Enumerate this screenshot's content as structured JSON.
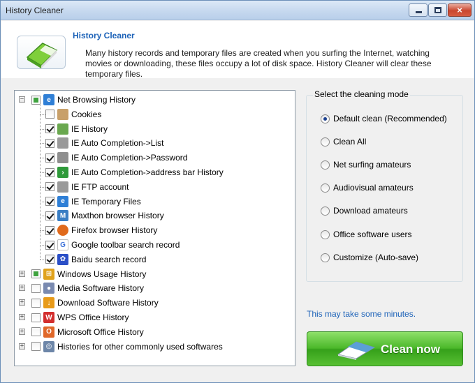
{
  "window": {
    "title": "History Cleaner",
    "controls": {
      "minimize": "minimize",
      "maximize": "maximize",
      "close": "×"
    }
  },
  "header": {
    "title": "History Cleaner",
    "description": "Many history records and temporary files are created when you surfing the Internet, watching movies or downloading, these files occupy a lot of disk space. History Cleaner will clear these temporary files."
  },
  "tree": {
    "groups": [
      {
        "label": "Net Browsing History",
        "state": "partial",
        "expanded": true,
        "icon": "ie-icon",
        "children": [
          {
            "label": "Cookies",
            "checked": false,
            "icon": "cookie-icon"
          },
          {
            "label": "IE History",
            "checked": true,
            "icon": "history-icon"
          },
          {
            "label": "IE Auto Completion->List",
            "checked": true,
            "icon": "autocomplete-icon"
          },
          {
            "label": "IE Auto Completion->Password",
            "checked": true,
            "icon": "password-icon"
          },
          {
            "label": "IE Auto Completion->address bar History",
            "checked": true,
            "icon": "arrow-icon"
          },
          {
            "label": "IE FTP account",
            "checked": true,
            "icon": "ftp-icon"
          },
          {
            "label": "IE Temporary Files",
            "checked": true,
            "icon": "ie-icon"
          },
          {
            "label": "Maxthon browser  History",
            "checked": true,
            "icon": "maxthon-icon"
          },
          {
            "label": "Firefox browser History",
            "checked": true,
            "icon": "firefox-icon"
          },
          {
            "label": "Google toolbar search record",
            "checked": true,
            "icon": "google-icon"
          },
          {
            "label": "Baidu search record",
            "checked": true,
            "icon": "baidu-icon"
          }
        ]
      },
      {
        "label": "Windows Usage History",
        "state": "partial",
        "icon": "windows-icon"
      },
      {
        "label": "Media Software History",
        "state": "unchecked",
        "icon": "media-icon"
      },
      {
        "label": "Download Software History",
        "state": "unchecked",
        "icon": "download-icon"
      },
      {
        "label": "WPS Office History",
        "state": "unchecked",
        "icon": "wps-icon"
      },
      {
        "label": "Microsoft Office History",
        "state": "unchecked",
        "icon": "office-icon"
      },
      {
        "label": "Histories for other commonly used softwares",
        "state": "unchecked",
        "icon": "software-icon"
      }
    ]
  },
  "mode": {
    "title": "Select the cleaning mode",
    "options": [
      "Default clean (Recommended)",
      "Clean All",
      "Net surfing amateurs",
      "Audiovisual amateurs",
      "Download amateurs",
      "Office software users",
      "Customize (Auto-save)"
    ],
    "selected_index": 0
  },
  "note": "This may take some minutes.",
  "clean_button": "Clean now",
  "colors": {
    "accent_blue": "#1c62b8",
    "button_green": "#4bb82a"
  }
}
